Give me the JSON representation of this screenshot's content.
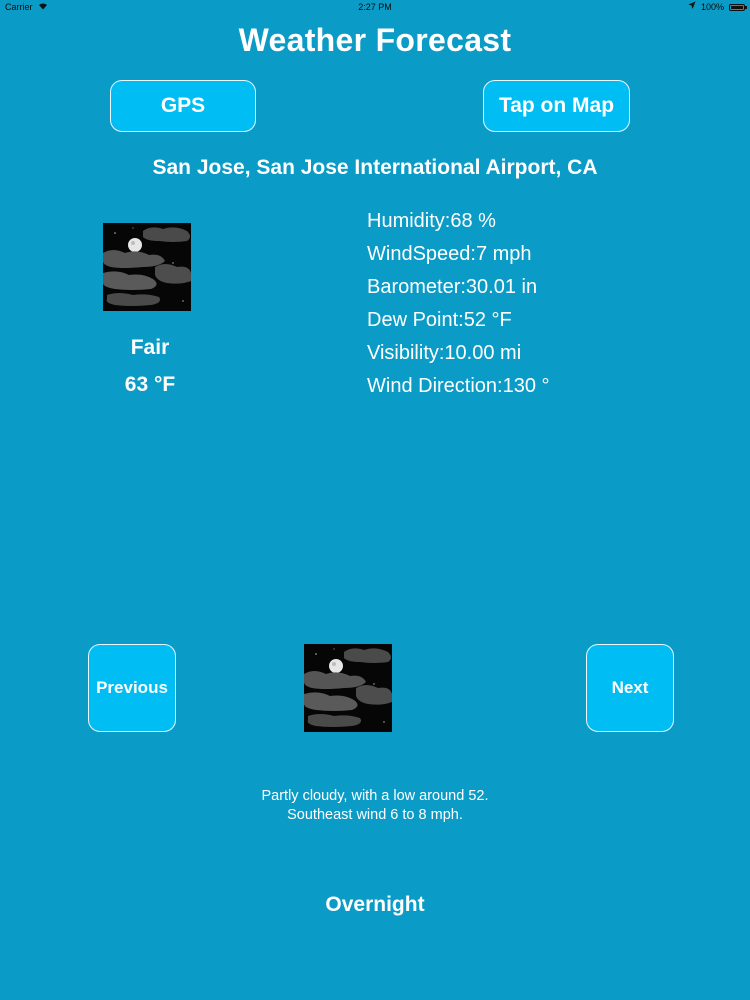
{
  "status_bar": {
    "carrier": "Carrier",
    "time": "2:27 PM",
    "battery": "100%"
  },
  "header": {
    "title": "Weather Forecast"
  },
  "toolbar": {
    "gps_label": "GPS",
    "map_label": "Tap on Map"
  },
  "location": "San Jose, San Jose International Airport, CA",
  "current": {
    "icon": "night-partly-cloudy-icon",
    "condition": "Fair",
    "temperature": "63 °F",
    "details": [
      "Humidity:68 %",
      "WindSpeed:7 mph",
      "Barometer:30.01 in",
      "Dew Point:52 °F",
      "Visibility:10.00 mi",
      "Wind Direction:130 °"
    ]
  },
  "forecast": {
    "previous_label": "Previous",
    "next_label": "Next",
    "icon": "night-partly-cloudy-icon",
    "text_line1": "Partly cloudy, with a low around 52.",
    "text_line2": "Southeast wind 6 to 8 mph.",
    "period": "Overnight"
  },
  "colors": {
    "background": "#0a9cc7",
    "button": "#00bdf4",
    "text": "#ffffff"
  }
}
